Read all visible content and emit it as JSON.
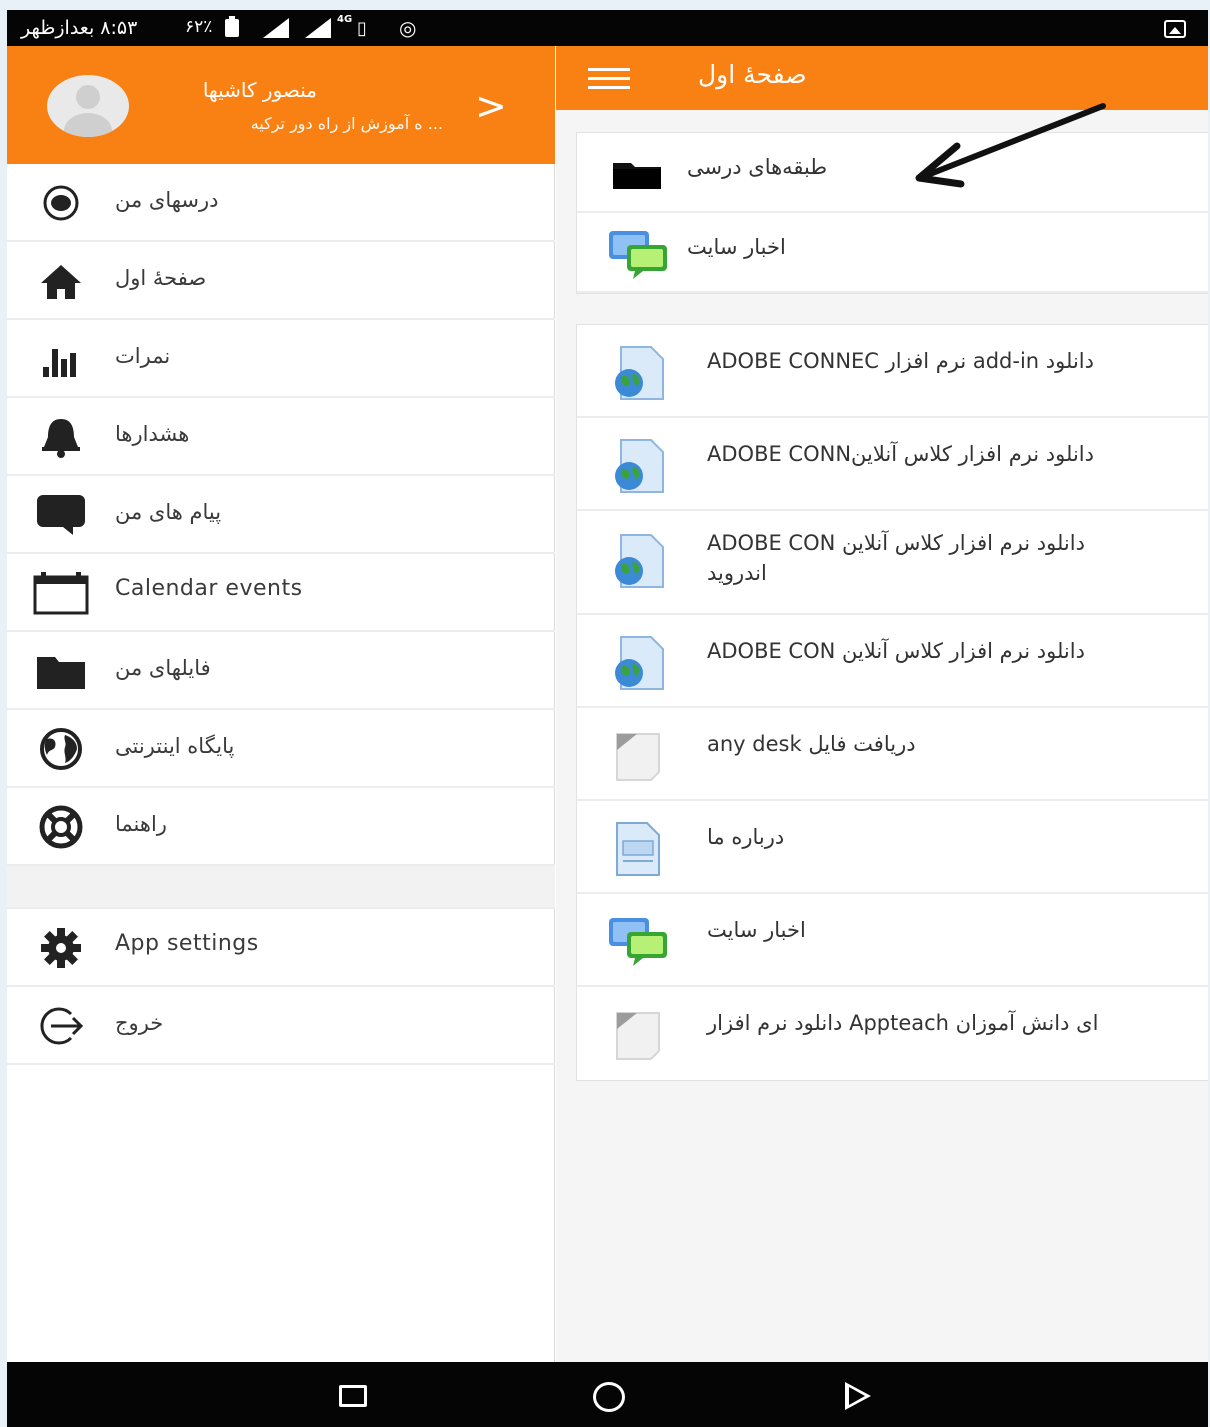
{
  "status_bar": {
    "time_text": "۸:۵۳ بعدازظهر",
    "battery_text": "۶۲٪",
    "network": "4G"
  },
  "user": {
    "name": "منصور کاشیها",
    "site": "... ه آموزش از راه دور ترکیه"
  },
  "app_bar": {
    "title": "صفحهٔ اول"
  },
  "menu": [
    {
      "label": "درسهای من",
      "icon": "target-icon"
    },
    {
      "label": "صفحهٔ اول",
      "icon": "home-icon"
    },
    {
      "label": "نمرات",
      "icon": "bar-chart-icon"
    },
    {
      "label": "هشدارها",
      "icon": "bell-icon"
    },
    {
      "label": "پیام های من",
      "icon": "chat-icon"
    },
    {
      "label": "Calendar events",
      "icon": "calendar-icon"
    },
    {
      "label": "فایلهای من",
      "icon": "folder-icon"
    },
    {
      "label": "پایگاه اینترنتی",
      "icon": "globe-icon"
    },
    {
      "label": "راهنما",
      "icon": "lifebuoy-icon"
    }
  ],
  "menu_bottom": [
    {
      "label": "App settings",
      "icon": "gear-icon"
    },
    {
      "label": "خروج",
      "icon": "logout-icon"
    }
  ],
  "top_list": [
    {
      "label": "طبقه‌های درسی",
      "icon": "folder-icon"
    },
    {
      "label": "اخبار سایت",
      "icon": "forum-icon"
    }
  ],
  "content_list": [
    {
      "label": "ADOBE CONNEC نرم افزار add-in دانلود",
      "icon": "url-resource-icon"
    },
    {
      "label": "ADOBE CONNدانلود نرم افزار کلاس آنلاین",
      "icon": "url-resource-icon"
    },
    {
      "label": "ADOBE CON دانلود نرم افزار کلاس آنلاین",
      "label2": "اندروید",
      "icon": "url-resource-icon"
    },
    {
      "label": "ADOBE CON دانلود نرم افزار کلاس آنلاین",
      "icon": "url-resource-icon"
    },
    {
      "label": "any desk دریافت فایل",
      "icon": "file-icon"
    },
    {
      "label": "درباره ما",
      "icon": "page-icon"
    },
    {
      "label": "اخبار سایت",
      "icon": "forum-icon"
    },
    {
      "label": "ای دانش آموزان Appteach دانلود نرم افزار",
      "icon": "file-icon"
    }
  ],
  "colors": {
    "accent": "#f98012",
    "status_bar": "#050505",
    "menu_icon": "#222222"
  }
}
